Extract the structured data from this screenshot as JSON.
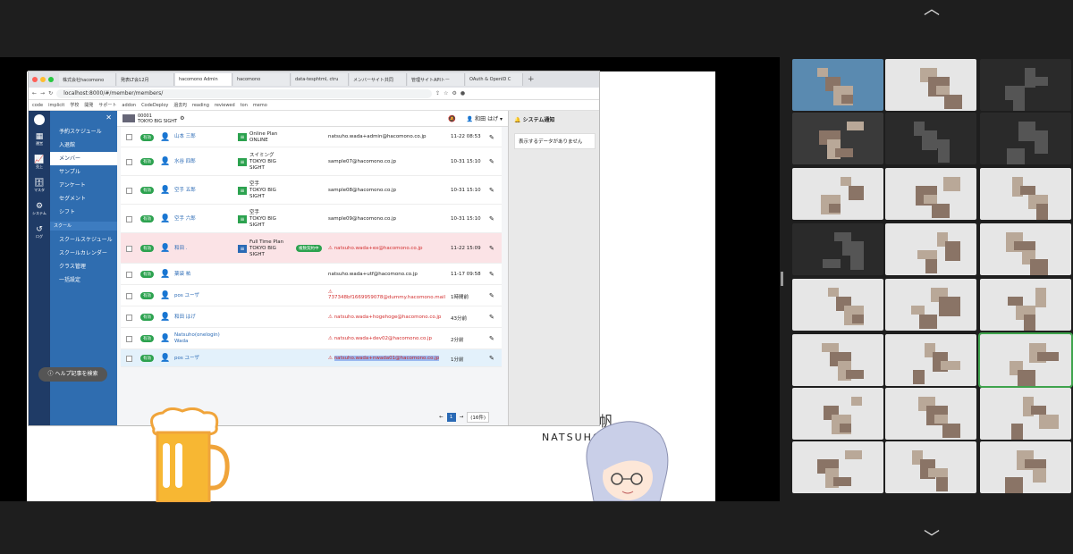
{
  "meeting": {
    "chevron_up": "︿",
    "chevron_down": "﹀"
  },
  "browser": {
    "tabs": [
      {
        "label": "株式会社hacomono",
        "active": false
      },
      {
        "label": "発表LT会12月",
        "active": false
      },
      {
        "label": "hacomono Admin",
        "active": true
      },
      {
        "label": "hacomono",
        "active": false
      },
      {
        "label": "data-tesphtml, ctru",
        "active": false
      },
      {
        "label": "メンバーサイト共同",
        "active": false
      },
      {
        "label": "管理サイトAPIトー",
        "active": false
      },
      {
        "label": "OAuth & OpenID C",
        "active": false
      }
    ],
    "url": "localhost:8000/#/member/members/",
    "bookmarks": [
      "code",
      "implicit",
      "学校",
      "開発",
      "サポート",
      "addon",
      "CodeDeploy",
      "過去PJ",
      "reading",
      "reviewed",
      "ton",
      "memo"
    ]
  },
  "app": {
    "rail": [
      {
        "icon": "▦",
        "label": "運営"
      },
      {
        "icon": "📈",
        "label": "売上"
      },
      {
        "icon": "🗄",
        "label": "マスタ"
      },
      {
        "icon": "⚙",
        "label": "システム"
      },
      {
        "icon": "↺",
        "label": "ログ"
      }
    ],
    "menu_items": [
      "予約スケジュール",
      "入退館",
      "メンバー",
      "サンプル",
      "アンケート",
      "セグメント",
      "シフト"
    ],
    "menu_section": "スクール",
    "menu_items2": [
      "スクールスケジュール",
      "スクールカレンダー",
      "クラス管理",
      "一括設定"
    ],
    "help_button": "ヘルプ記事を検索",
    "studio_code": "00001",
    "studio_name": "TOKYO BIG SIGHT",
    "user_name": "和田 はげ",
    "notice_title": "システム通知",
    "notice_empty": "表示するデータがありません",
    "members": [
      {
        "status": "有効",
        "name": "山本 三郎",
        "plan": "Online Plan\nONLINE",
        "contract": "",
        "email": "natsuho.wada+admin@hacomono.co.jp",
        "time": "11-22 08:53",
        "warn": false,
        "style": "white"
      },
      {
        "status": "有効",
        "name": "水谷 四郎",
        "plan": "スイミング\nTOKYO BIG\nSIGHT",
        "contract": "",
        "email": "sample07@hacomono.co.jp",
        "time": "10-31 15:10",
        "warn": false,
        "style": "white"
      },
      {
        "status": "有効",
        "name": "空手 五郎",
        "plan": "空手\nTOKYO BIG\nSIGHT",
        "contract": "",
        "email": "sample08@hacomono.co.jp",
        "time": "10-31 15:10",
        "warn": false,
        "style": "white"
      },
      {
        "status": "有効",
        "name": "空手 六郎",
        "plan": "空手\nTOKYO BIG\nSIGHT",
        "contract": "",
        "email": "sample09@hacomono.co.jp",
        "time": "10-31 15:10",
        "warn": false,
        "style": "white"
      },
      {
        "status": "有効",
        "name": "和田 .",
        "plan": "Full Time Plan\nTOKYO BIG\nSIGHT",
        "contract": "複数契約中",
        "email": "natsuho.wada+ex@hacomono.co.jp",
        "time": "11-22 15:09",
        "warn": true,
        "style": "pink"
      },
      {
        "status": "有効",
        "name": "薬袋 祐",
        "plan": "",
        "contract": "",
        "email": "natsuho.wada+utf@hacomono.co.jp",
        "time": "11-17 09:58",
        "warn": false,
        "style": "white"
      },
      {
        "status": "有効",
        "name": "pos ユーザ",
        "plan": "",
        "contract": "",
        "email": "737348bf1669959078@dummy.hacomono.mail",
        "time": "1時間前",
        "warn": true,
        "style": "white"
      },
      {
        "status": "有効",
        "name": "和田 はげ",
        "plan": "",
        "contract": "",
        "email": "natsuho.wada+hogehoge@hacomono.co.jp",
        "time": "43分前",
        "warn": true,
        "style": "white"
      },
      {
        "status": "有効",
        "name": "Natsuho(onelogin)\nWada",
        "plan": "",
        "contract": "",
        "email": "natsuho.wada+dev02@hacomono.co.jp",
        "time": "2分前",
        "warn": true,
        "style": "white"
      },
      {
        "status": "有効",
        "name": "pos ユーザ",
        "plan": "",
        "contract": "",
        "email": "natsuho.wada+nwada01@hacomono.co.jp",
        "time": "1分前",
        "warn": true,
        "style": "blue"
      }
    ],
    "pager": {
      "prev": "←",
      "current": "1",
      "next": "→",
      "total": "(16件)"
    }
  },
  "slide": {
    "caption": "NATSUHO",
    "kanji": "帆"
  }
}
